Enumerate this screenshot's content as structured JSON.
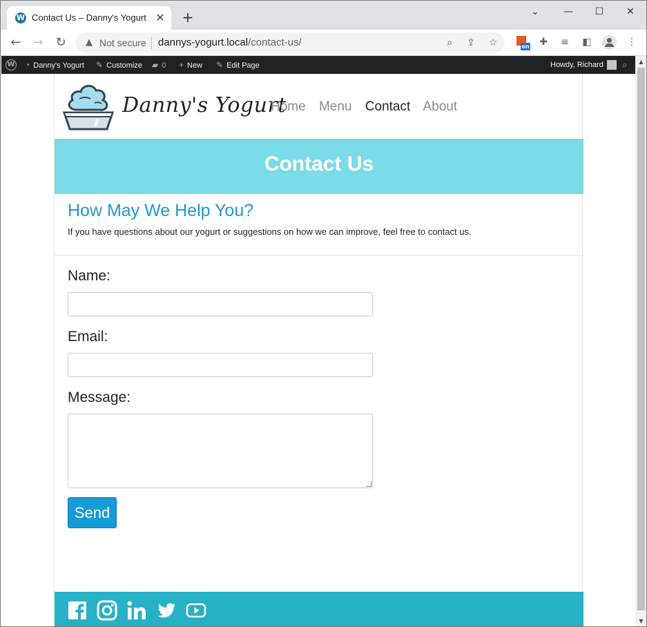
{
  "browser": {
    "tab_title": "Contact Us – Danny's Yogurt",
    "security_label": "Not secure",
    "url_host": "dannys-yogurt.local",
    "url_path": "/contact-us/"
  },
  "adminbar": {
    "site_name": "Danny's Yogurt",
    "customize": "Customize",
    "comments_count": "0",
    "new": "New",
    "edit_page": "Edit Page",
    "howdy": "Howdy, Richard"
  },
  "site": {
    "name": "Danny's Yogurt",
    "nav": [
      "Home",
      "Menu",
      "Contact",
      "About"
    ],
    "active_nav": "Contact"
  },
  "hero": {
    "title": "Contact Us"
  },
  "intro": {
    "heading": "How May We Help You?",
    "text": "If you have questions about our yogurt or suggestions on how we can improve, feel free to contact us."
  },
  "form": {
    "name_label": "Name:",
    "name_value": "",
    "email_label": "Email:",
    "email_value": "",
    "message_label": "Message:",
    "message_value": "",
    "send_label": "Send"
  },
  "footer": {
    "social_icons": [
      "facebook-icon",
      "instagram-icon",
      "linkedin-icon",
      "twitter-icon",
      "youtube-icon"
    ]
  },
  "colors": {
    "hero_bg": "#7bdbe6",
    "heading": "#2596d2",
    "button": "#159bd7",
    "footer_bg": "#27b1c6",
    "adminbar_bg": "#1d2327"
  }
}
